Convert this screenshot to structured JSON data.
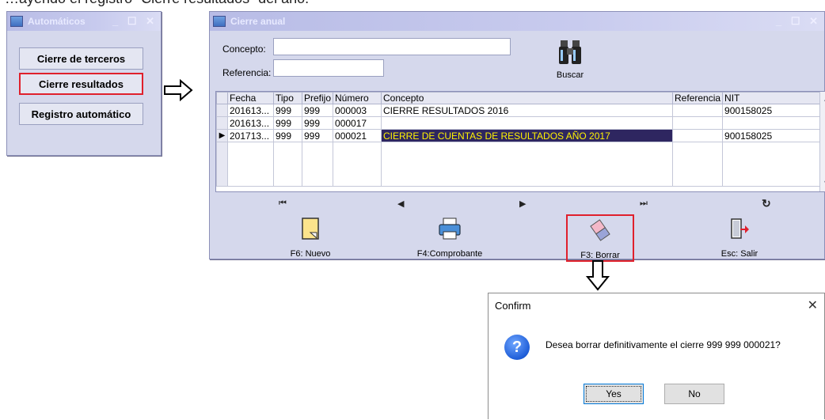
{
  "cut_text": "…ayendo el registro “Cierre resultados” del año.",
  "automaticos": {
    "title": "Automáticos",
    "controls": "_ ☐ ✕",
    "buttons": [
      "Cierre de terceros",
      "Cierre resultados",
      "Registro automático"
    ]
  },
  "cierre": {
    "title": "Cierre anual",
    "controls": "_ ☐ ✕",
    "concepto_label": "Concepto:",
    "referencia_label": "Referencia:",
    "buscar_label": "Buscar",
    "columns": [
      "Fecha",
      "Tipo",
      "Prefijo",
      "Número",
      "Concepto",
      "Referencia",
      "NIT"
    ],
    "rows": [
      {
        "indicator": "",
        "fecha": "201613...",
        "tipo": "999",
        "prefijo": "999",
        "numero": "000003",
        "concepto": "CIERRE RESULTADOS 2016",
        "referencia": "",
        "nit": "900158025"
      },
      {
        "indicator": "",
        "fecha": "201613...",
        "tipo": "999",
        "prefijo": "999",
        "numero": "000017",
        "concepto": "",
        "referencia": "",
        "nit": ""
      },
      {
        "indicator": "▶",
        "fecha": "201713...",
        "tipo": "999",
        "prefijo": "999",
        "numero": "000021",
        "concepto": "CIERRE DE CUENTAS DE RESULTADOS AÑO 2017",
        "referencia": "",
        "nit": "900158025"
      }
    ],
    "nav": {
      "first": "⏮",
      "prev": "◀",
      "next": "▶",
      "last": "⏭",
      "refresh": "↻"
    },
    "toolbar": [
      "F6: Nuevo",
      "F4:Comprobante",
      "F3: Borrar",
      "Esc: Salir"
    ]
  },
  "confirm": {
    "title": "Confirm",
    "close": "✕",
    "message": "Desea borrar definitivamente el cierre 999 999 000021?",
    "yes": "Yes",
    "no": "No"
  }
}
